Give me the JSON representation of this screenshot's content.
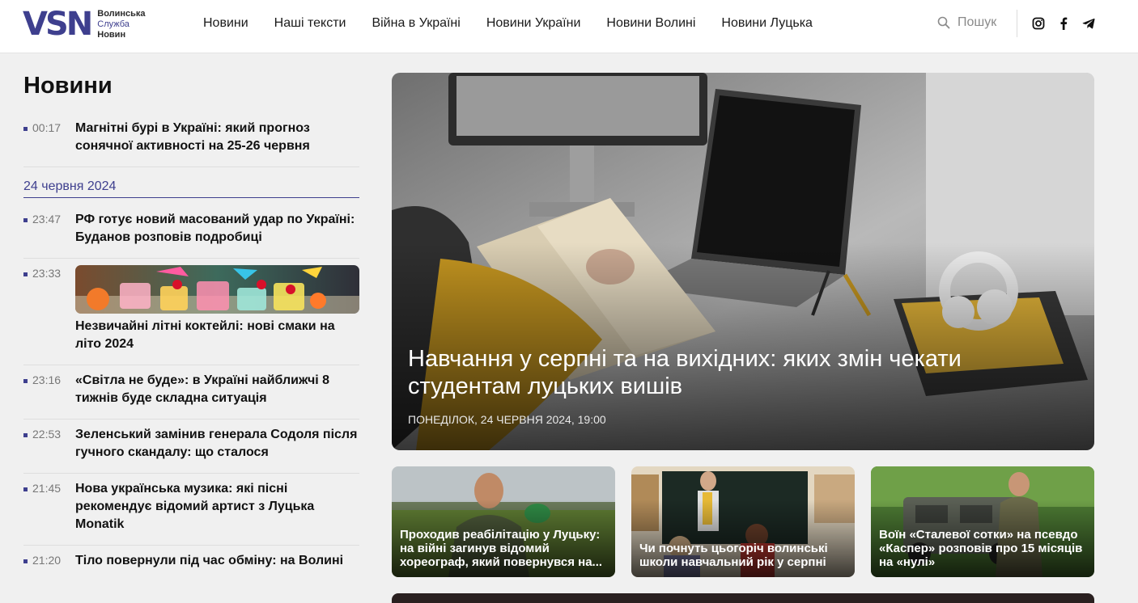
{
  "header": {
    "logo": {
      "mark": "VSN",
      "line1": "Волинська",
      "line2": "Служба",
      "line3": "Новин"
    },
    "nav": [
      "Новини",
      "Наші тексти",
      "Війна в Україні",
      "Новини України",
      "Новини Волині",
      "Новини Луцька"
    ],
    "search_label": "Пошук",
    "social_icons": [
      "instagram-icon",
      "facebook-icon",
      "telegram-icon"
    ]
  },
  "feed": {
    "title": "Новини",
    "first_item": {
      "time": "00:17",
      "title": "Магнітні бурі в Україні: який прогноз сонячної активності на 25-26 червня"
    },
    "date_separator": "24 червня 2024",
    "items": [
      {
        "time": "23:47",
        "title": "РФ готує новий масований удар по Україні: Буданов розповів подробиці"
      },
      {
        "time": "23:33",
        "title": "Незвичайні літні коктейлі: нові смаки на літо 2024",
        "has_image": true
      },
      {
        "time": "23:16",
        "title": "«Світла не буде»: в Україні найближчі 8 тижнів буде складна ситуація"
      },
      {
        "time": "22:53",
        "title": "Зеленський замінив генерала Содоля після гучного скандалу: що сталося"
      },
      {
        "time": "21:45",
        "title": "Нова українська музика: які пісні рекомендує відомий артист з Луцька Monatik"
      },
      {
        "time": "21:20",
        "title": "Тіло повернули під час обміну: на Волині"
      }
    ]
  },
  "hero": {
    "title": "Навчання у серпні та на вихідних: яких змін чекати студентам луцьких вишів",
    "meta": "Понеділок, 24 червня 2024, 19:00"
  },
  "cards": [
    {
      "title": "Проходив реабілітацію у Луцьку: на війні загинув відомий хореограф, який повернувся на..."
    },
    {
      "title": "Чи почнуть цьогоріч волинські школи навчальний рік у серпні"
    },
    {
      "title": "Воїн «Сталевої сотки» на псевдо «Каспер» розповів про 15 місяців на «нулі»"
    }
  ],
  "colors": {
    "brand": "#3e3f8e",
    "background": "#f0f0f0"
  }
}
